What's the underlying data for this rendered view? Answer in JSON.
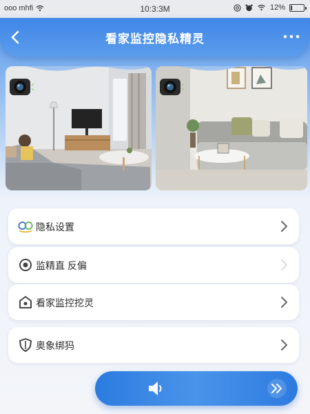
{
  "status_bar": {
    "carrier": "ooo mhfi",
    "time": "10:3:3M",
    "battery": "12%",
    "battery_level": 0.12
  },
  "header": {
    "title": "看家监控隐私精灵",
    "back_icon": "chevron-left-icon",
    "more_icon": "more-dots-icon"
  },
  "feeds": [
    {
      "name": "living-room-feed-1",
      "icon": "camera-icon"
    },
    {
      "name": "living-room-feed-2",
      "icon": "camera-icon"
    }
  ],
  "menu": {
    "items": [
      {
        "label": "隐私设置",
        "icon": "privacy-toggle-icon"
      },
      {
        "label": "监精直 反偏",
        "icon": "circle-target-icon"
      },
      {
        "label": "看家监控挖灵",
        "icon": "home-shield-icon"
      },
      {
        "label": "奥象绑犸",
        "icon": "shield-icon"
      }
    ]
  },
  "bottom_bar": {
    "speaker_icon": "speaker-icon",
    "forward_icon": "double-chevron-right-icon"
  },
  "colors": {
    "accent": "#3f86e6",
    "background": "#f3f5f9",
    "card": "#ffffff"
  }
}
